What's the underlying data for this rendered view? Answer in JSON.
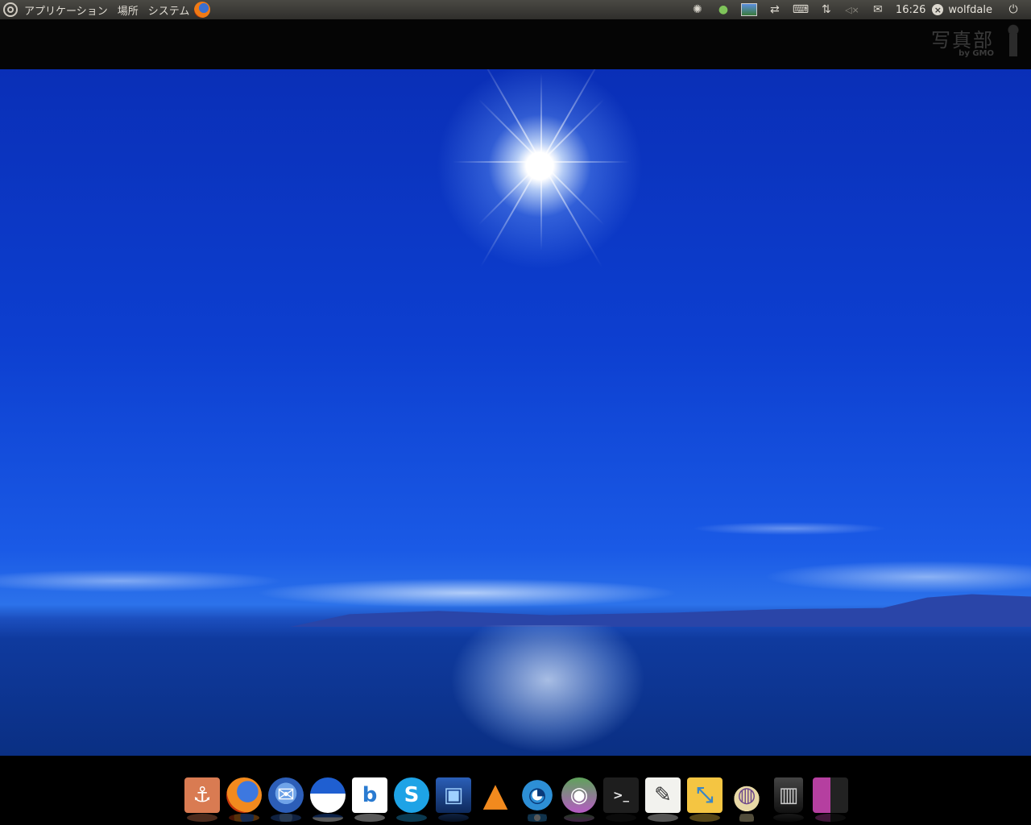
{
  "top_panel": {
    "menus": [
      "アプリケーション",
      "場所",
      "システム"
    ],
    "clock": "16:26",
    "username": "wolfdale",
    "tray_icons": [
      "network-swirl-icon",
      "tor-onion-icon",
      "display-icon",
      "sync-icon",
      "keyboard-icon",
      "network-updown-icon",
      "volume-muted-icon",
      "mail-icon"
    ],
    "mute_glyph": "◁×",
    "updown_glyph": "⇅",
    "mail_glyph": "✉",
    "keyboard_glyph": "⌨",
    "power_glyph": "⏻"
  },
  "watermark": {
    "title": "写真部",
    "subtitle": "by GMO"
  },
  "dock": {
    "items": [
      {
        "name": "docky-anchor-icon",
        "glyph": "⚓",
        "bg": "#d97b52",
        "fg": "#ffffff"
      },
      {
        "name": "firefox-icon",
        "glyph": "",
        "bg": "radial-gradient(circle at 60% 40%,#3d78e0 0 35%,#f28a1e 36% 68%,#c7360b 69%)",
        "fg": "#fff"
      },
      {
        "name": "thunderbird-icon",
        "glyph": "✉",
        "bg": "radial-gradient(circle at 50% 45%,#6fa3e8 0 40%,#2c5eb8 41%)",
        "fg": "#ffffff"
      },
      {
        "name": "browser-icon",
        "glyph": "",
        "bg": "linear-gradient(#1f5fd1 0 45%,#ffffff 46%)",
        "fg": "#fff"
      },
      {
        "name": "banshee-icon",
        "glyph": "b",
        "bg": "#ffffff",
        "fg": "#2a7bd1"
      },
      {
        "name": "skype-icon",
        "glyph": "S",
        "bg": "#1ea3e6",
        "fg": "#ffffff"
      },
      {
        "name": "image-viewer-icon",
        "glyph": "▣",
        "bg": "linear-gradient(#2b5fb8,#0e2a5c)",
        "fg": "#9fd0ff"
      },
      {
        "name": "vlc-icon",
        "glyph": "▲",
        "bg": "transparent",
        "fg": "#f28a1e"
      },
      {
        "name": "shutter-icon",
        "glyph": "◔",
        "bg": "radial-gradient(circle,#ffffff 0 20%,#2d8fd6 21% 60%,transparent 61%)",
        "fg": "#0a3a7a"
      },
      {
        "name": "network-desktop-icon",
        "glyph": "◉",
        "bg": "linear-gradient(#5ea35a,#b65bc4)",
        "fg": "#ffffff"
      },
      {
        "name": "terminal-icon",
        "glyph": ">_",
        "bg": "#1e1e1e",
        "fg": "#e8e8e8"
      },
      {
        "name": "text-editor-icon",
        "glyph": "✎",
        "bg": "#f2f2ee",
        "fg": "#333333"
      },
      {
        "name": "vmware-icon",
        "glyph": "⤡",
        "bg": "#f4c542",
        "fg": "#3a86c6"
      },
      {
        "name": "tor-browser-icon",
        "glyph": "◍",
        "bg": "radial-gradient(circle at 50% 60%,#e8d9a6 0 45%,transparent 46%)",
        "fg": "#6e4a8c"
      },
      {
        "name": "trash-icon",
        "glyph": "▥",
        "bg": "linear-gradient(#444,#111)",
        "fg": "#cccccc"
      },
      {
        "name": "workspace-switcher-icon",
        "glyph": "",
        "bg": "linear-gradient(90deg,#b53fa0 0 50%,#222 50%)",
        "fg": "#fff"
      }
    ]
  }
}
